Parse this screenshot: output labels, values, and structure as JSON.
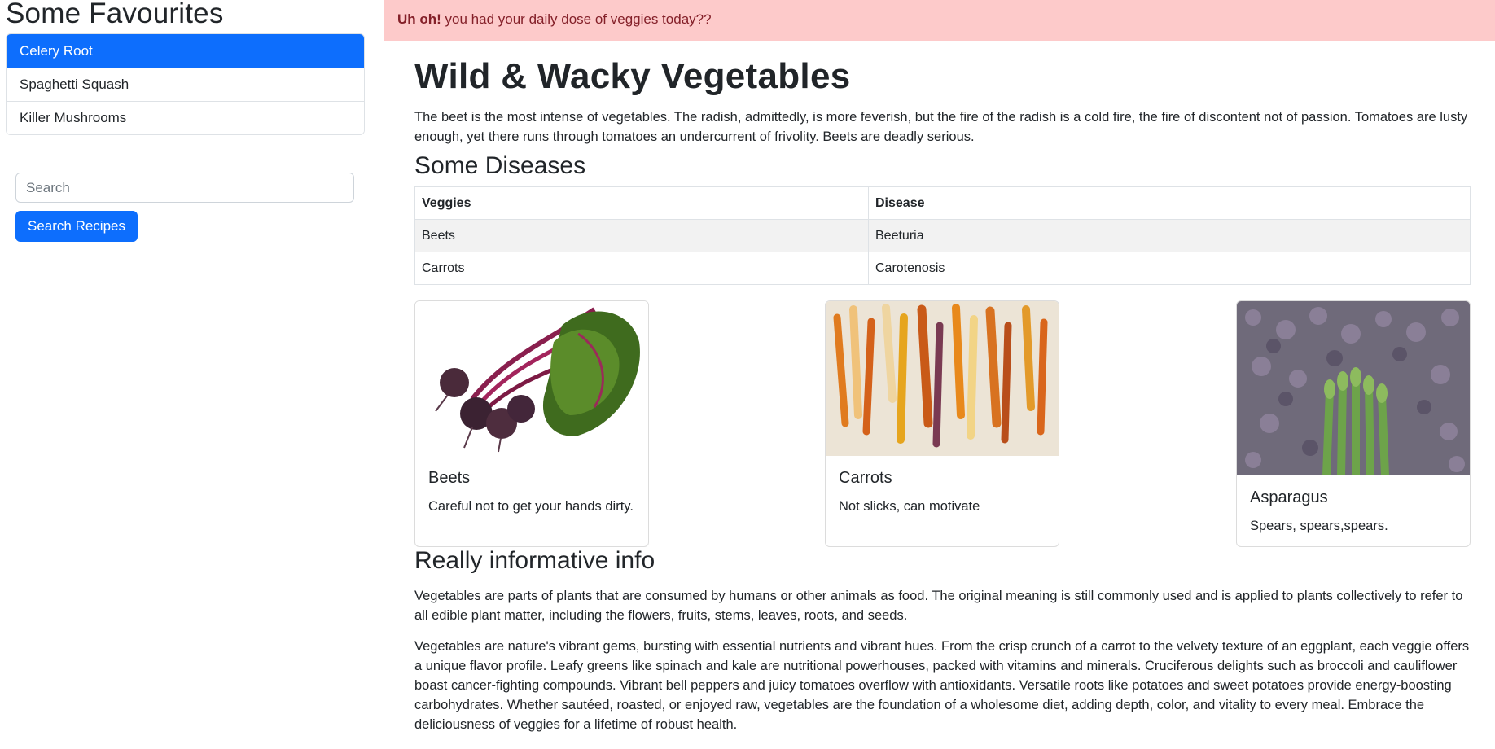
{
  "sidebar": {
    "title": "Some Favourites",
    "favourites": [
      "Celery Root",
      "Spaghetti Squash",
      "Killer Mushrooms"
    ],
    "active_index": 0,
    "search_placeholder": "Search",
    "search_button": "Search Recipes"
  },
  "alert": {
    "strong": "Uh oh!",
    "text": " you had your daily dose of veggies today??"
  },
  "main": {
    "title": "Wild & Wacky Vegetables",
    "intro": "The beet is the most intense of vegetables. The radish, admittedly, is more feverish, but the fire of the radish is a cold fire, the fire of discontent not of passion. Tomatoes are lusty enough, yet there runs through tomatoes an undercurrent of frivolity. Beets are deadly serious.",
    "diseases": {
      "title": "Some Diseases",
      "headers": [
        "Veggies",
        "Disease"
      ],
      "rows": [
        [
          "Beets",
          "Beeturia"
        ],
        [
          "Carrots",
          "Carotenosis"
        ]
      ]
    },
    "cards": [
      {
        "title": "Beets",
        "text": "Careful not to get your hands dirty."
      },
      {
        "title": "Carrots",
        "text": "Not slicks, can motivate"
      },
      {
        "title": "Asparagus",
        "text": "Spears, spears,spears."
      }
    ],
    "info": {
      "title": "Really informative info",
      "p1": "Vegetables are parts of plants that are consumed by humans or other animals as food. The original meaning is still commonly used and is applied to plants collectively to refer to all edible plant matter, including the flowers, fruits, stems, leaves, roots, and seeds.",
      "p2": "Vegetables are nature's vibrant gems, bursting with essential nutrients and vibrant hues. From the crisp crunch of a carrot to the velvety texture of an eggplant, each veggie offers a unique flavor profile. Leafy greens like spinach and kale are nutritional powerhouses, packed with vitamins and minerals. Cruciferous delights such as broccoli and cauliflower boast cancer-fighting compounds. Vibrant bell peppers and juicy tomatoes overflow with antioxidants. Versatile roots like potatoes and sweet potatoes provide energy-boosting carbohydrates. Whether sautéed, roasted, or enjoyed raw, vegetables are the foundation of a wholesome diet, adding depth, color, and vitality to every meal. Embrace the deliciousness of veggies for a lifetime of robust health."
    }
  }
}
